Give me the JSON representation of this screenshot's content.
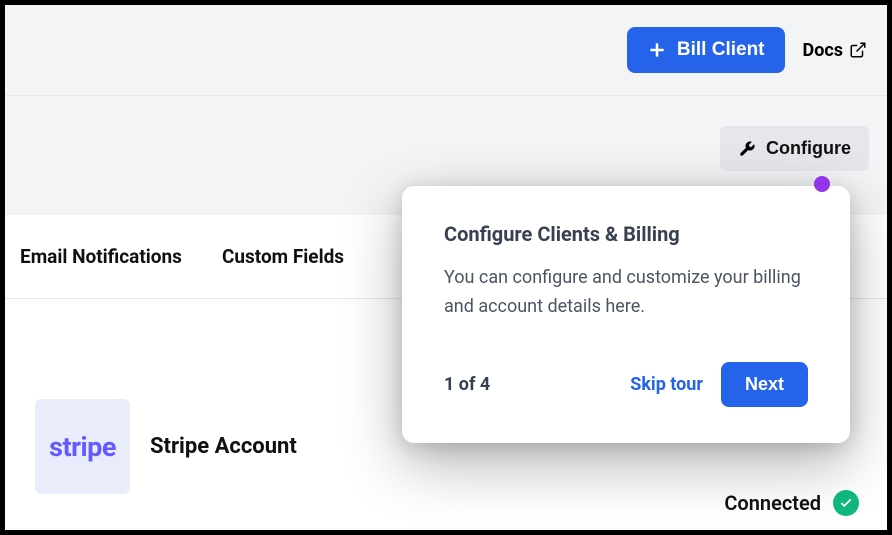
{
  "header": {
    "bill_client_label": "Bill Client",
    "docs_label": "Docs"
  },
  "subheader": {
    "configure_label": "Configure"
  },
  "tabs": {
    "email_notifications": "Email Notifications",
    "custom_fields": "Custom Fields"
  },
  "stripe": {
    "logo_text": "stripe",
    "title": "Stripe Account",
    "status": "Connected"
  },
  "tour": {
    "title": "Configure Clients & Billing",
    "body": "You can configure and customize your billing and account details here.",
    "step": "1 of 4",
    "skip_label": "Skip tour",
    "next_label": "Next"
  }
}
